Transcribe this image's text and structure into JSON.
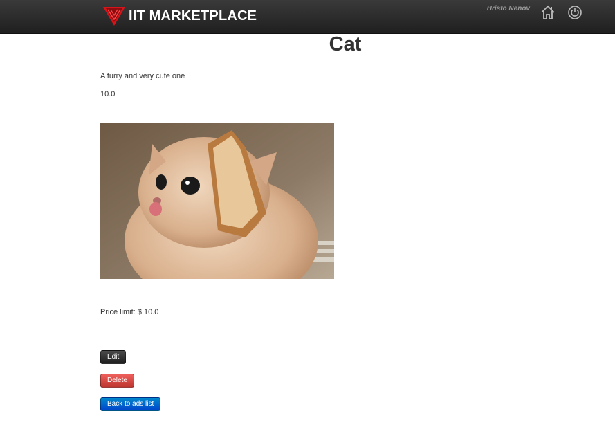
{
  "header": {
    "brand": "IIT MARKETPLACE",
    "user_name": "Hristo Nenov",
    "icons": [
      "logo-icon",
      "home-icon",
      "power-icon"
    ],
    "colors": {
      "navbar": "#2a2a2a",
      "logo_red": "#d7141a"
    }
  },
  "ad": {
    "title": "Cat",
    "description": "A furry and very cute one",
    "price": "10.0",
    "price_limit_label": "Price limit: $",
    "price_limit_value": "10.0",
    "image_alt": "Cat with bread slice around its face"
  },
  "actions": {
    "edit_label": "Edit",
    "delete_label": "Delete",
    "back_label": "Back to ads list",
    "colors": {
      "edit": "#222222",
      "delete": "#da4f49",
      "back": "#0066cc"
    }
  }
}
